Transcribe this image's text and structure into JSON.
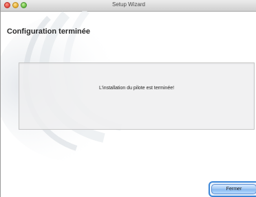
{
  "window": {
    "title": "Setup Wizard"
  },
  "page": {
    "title": "Configuration terminée"
  },
  "message": {
    "text": "L'installation du pilote est terminée!"
  },
  "buttons": {
    "fermer_label": "Fermer"
  }
}
